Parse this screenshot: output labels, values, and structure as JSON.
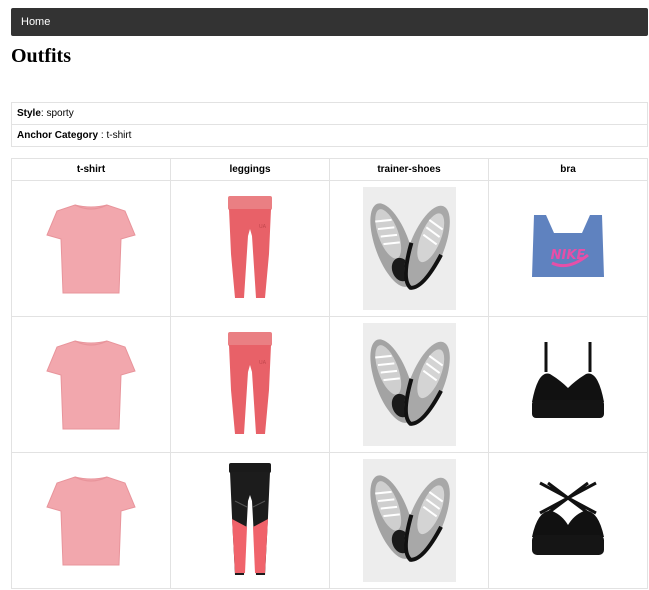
{
  "nav": {
    "home_label": "Home"
  },
  "page": {
    "title": "Outfits"
  },
  "info": {
    "style_label": "Style",
    "style_value": ": sporty",
    "anchor_label": "Anchor Category",
    "anchor_value": " : t-shirt"
  },
  "table": {
    "headers": [
      "t-shirt",
      "leggings",
      "trainer-shoes",
      "bra"
    ],
    "rows": [
      {
        "tshirt": "pink-tshirt",
        "leggings": "coral-leggings",
        "shoes": "grey-trainer-shoes",
        "bra": "blue-nike-sports-bra"
      },
      {
        "tshirt": "pink-tshirt",
        "leggings": "coral-leggings",
        "shoes": "grey-trainer-shoes",
        "bra": "black-sports-bra"
      },
      {
        "tshirt": "pink-tshirt",
        "leggings": "black-coral-leggings",
        "shoes": "grey-trainer-shoes",
        "bra": "black-strappy-sports-bra"
      }
    ],
    "bra_logo_text": "NIKE"
  },
  "colors": {
    "navbar": "#333333",
    "tshirt": "#f2a7ad",
    "leggings_coral": "#e86168",
    "bra_blue": "#5f82bf",
    "bra_logo": "#e64fa8"
  }
}
